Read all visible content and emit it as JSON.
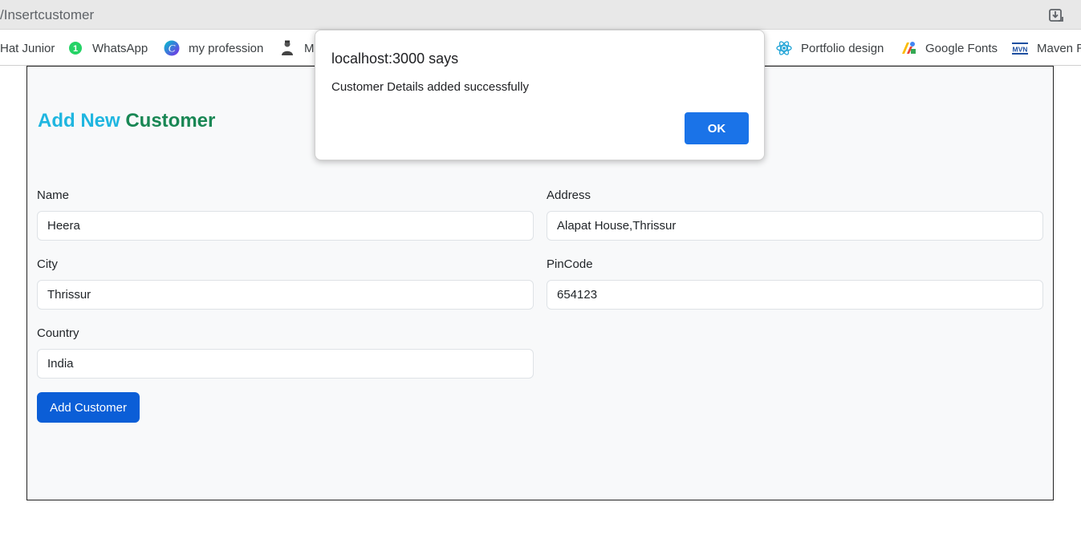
{
  "browser": {
    "address": "/Insertcustomer",
    "bookmarks": [
      {
        "label": "Hat Junior",
        "icon": "none"
      },
      {
        "label": "WhatsApp",
        "icon": "whatsapp-icon"
      },
      {
        "label": "my profession",
        "icon": "canva-icon"
      },
      {
        "label": "Mo",
        "icon": "user-icon"
      },
      {
        "label": "Portfolio design",
        "icon": "react-icon"
      },
      {
        "label": "Google Fonts",
        "icon": "google-fonts-icon"
      },
      {
        "label": "Maven R",
        "icon": "maven-icon"
      }
    ]
  },
  "form": {
    "heading_part1": "Add New",
    "heading_part2": "Customer",
    "name_label": "Name",
    "name_value": "Heera",
    "address_label": "Address",
    "address_value": "Alapat House,Thrissur",
    "city_label": "City",
    "city_value": "Thrissur",
    "pincode_label": "PinCode",
    "pincode_value": "654123",
    "country_label": "Country",
    "country_value": "India",
    "submit_label": "Add Customer"
  },
  "dialog": {
    "title": "localhost:3000 says",
    "message": "Customer Details added successfully",
    "ok_label": "OK"
  },
  "colors": {
    "heading_accent": "#1fb6e0",
    "heading_brand": "#198754",
    "primary_button": "#0b5ed7",
    "dialog_ok": "#1a73e8"
  }
}
